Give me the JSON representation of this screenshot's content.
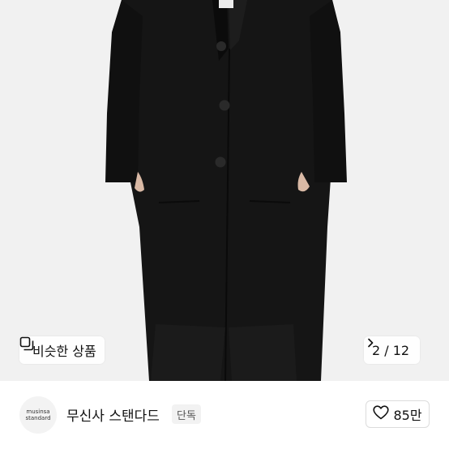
{
  "hero": {
    "similar_products_label": "비슷한 상품",
    "pager_label": "2 / 12"
  },
  "brand": {
    "logo_line1": "musinsa",
    "logo_line2": "standard",
    "name": "무신사 스탠다드",
    "exclusive_tag": "단독",
    "like_count": "85만"
  },
  "colors": {
    "coat": "#141414",
    "background": "#f1f1f1"
  }
}
